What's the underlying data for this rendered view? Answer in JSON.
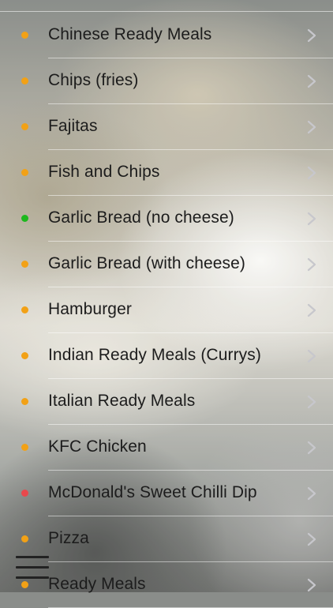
{
  "colors": {
    "orange": "#f2a116",
    "green": "#1db81d",
    "red": "#e8484c",
    "chevron": "#c7c7cc"
  },
  "menu_icon": "hamburger-menu-icon",
  "chevron_icon": "chevron-right-icon",
  "items": [
    {
      "label": "Chinese Ready Meals",
      "status": "orange"
    },
    {
      "label": "Chips (fries)",
      "status": "orange"
    },
    {
      "label": "Fajitas",
      "status": "orange"
    },
    {
      "label": "Fish and Chips",
      "status": "orange"
    },
    {
      "label": "Garlic Bread (no cheese)",
      "status": "green"
    },
    {
      "label": "Garlic Bread (with cheese)",
      "status": "orange"
    },
    {
      "label": "Hamburger",
      "status": "orange"
    },
    {
      "label": "Indian Ready Meals (Currys)",
      "status": "orange"
    },
    {
      "label": "Italian Ready Meals",
      "status": "orange"
    },
    {
      "label": "KFC Chicken",
      "status": "orange"
    },
    {
      "label": "McDonald's Sweet Chilli Dip",
      "status": "red"
    },
    {
      "label": "Pizza",
      "status": "orange"
    },
    {
      "label": "Ready Meals",
      "status": "orange"
    }
  ]
}
